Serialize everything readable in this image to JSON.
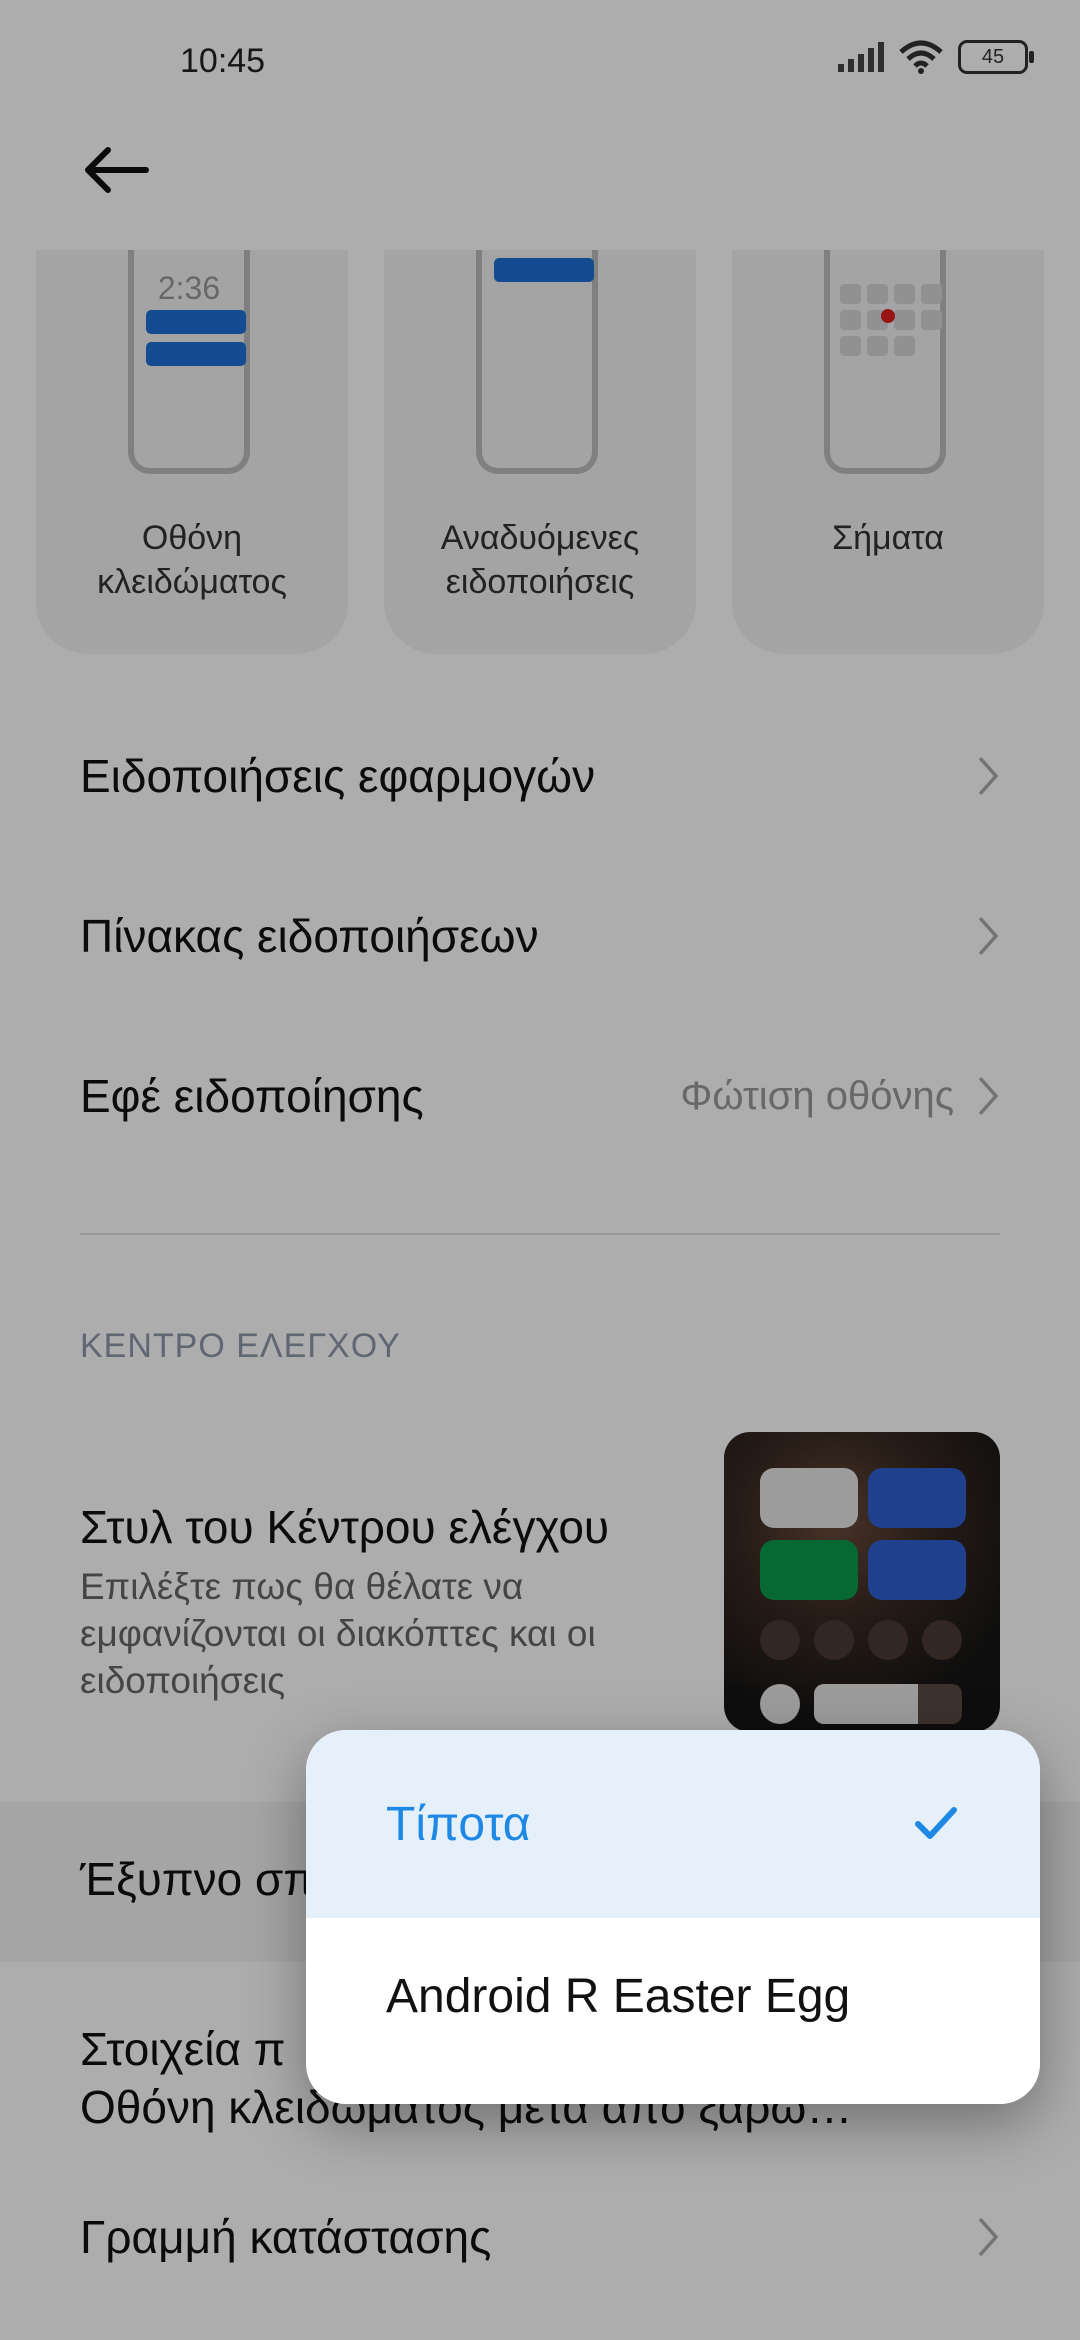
{
  "status_bar": {
    "time": "10:45",
    "battery": "45"
  },
  "cards": [
    {
      "label": "Οθόνη\nκλειδώματος",
      "preview_time": "2:36"
    },
    {
      "label": "Αναδυόμενες\nειδοποιήσεις"
    },
    {
      "label": "Σήματα"
    }
  ],
  "rows": {
    "app_notifications": "Ειδοποιήσεις εφαρμογών",
    "notification_panel": "Πίνακας ειδοποιήσεων",
    "notification_effect": "Εφέ ειδοποίησης",
    "notification_effect_value": "Φώτιση οθόνης"
  },
  "section_header": "ΚΕΝΤΡΟ ΕΛΕΓΧΟΥ",
  "control_center": {
    "title": "Στυλ του Κέντρου ελέγχου",
    "subtitle": "Επιλέξτε πως θα θέλατε να εμφανίζονται οι διακόπτες και οι ειδοποιήσεις"
  },
  "smart_row": {
    "label": "Έξυπνο σπ"
  },
  "lock_items_row": {
    "line1": "Στοιχεία π",
    "line2": "Οθόνη κλειδώματος μετά από ξαρω…"
  },
  "status_bar_row": {
    "label": "Γραμμή κατάστασης"
  },
  "popup": {
    "options": [
      {
        "label": "Τίποτα",
        "selected": true
      },
      {
        "label": "Android R Easter Egg",
        "selected": false
      }
    ]
  },
  "colors": {
    "accent": "#1e88e5",
    "selected_bg": "#e6f0fa",
    "tile_blue": "#2f5fd0",
    "tile_green": "#0a9a4a"
  }
}
